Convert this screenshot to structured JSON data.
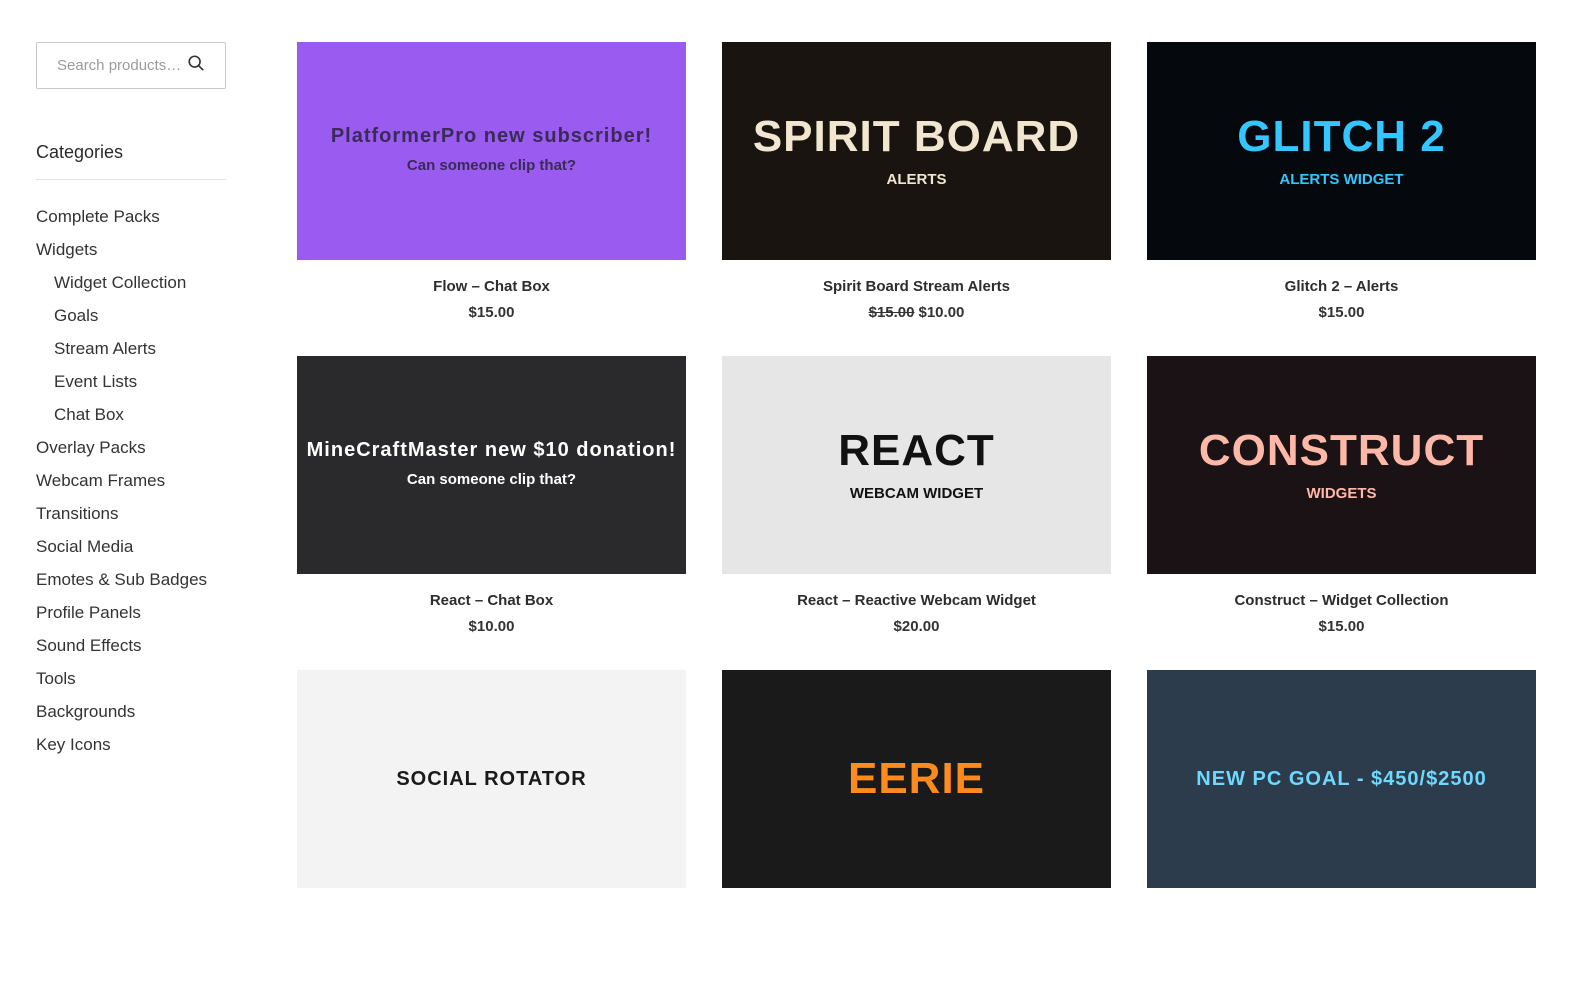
{
  "search": {
    "placeholder": "Search products…"
  },
  "sidebar": {
    "categories_title": "Categories",
    "items": [
      {
        "label": "Complete Packs",
        "sub": false
      },
      {
        "label": "Widgets",
        "sub": false
      },
      {
        "label": "Widget Collection",
        "sub": true
      },
      {
        "label": "Goals",
        "sub": true
      },
      {
        "label": "Stream Alerts",
        "sub": true
      },
      {
        "label": "Event Lists",
        "sub": true
      },
      {
        "label": "Chat Box",
        "sub": true
      },
      {
        "label": "Overlay Packs",
        "sub": false
      },
      {
        "label": "Webcam Frames",
        "sub": false
      },
      {
        "label": "Transitions",
        "sub": false
      },
      {
        "label": "Social Media",
        "sub": false
      },
      {
        "label": "Emotes & Sub Badges",
        "sub": false
      },
      {
        "label": "Profile Panels",
        "sub": false
      },
      {
        "label": "Sound Effects",
        "sub": false
      },
      {
        "label": "Tools",
        "sub": false
      },
      {
        "label": "Backgrounds",
        "sub": false
      },
      {
        "label": "Key Icons",
        "sub": false
      }
    ]
  },
  "products": [
    {
      "name": "Flow – Chat Box",
      "price": "$15.00",
      "old_price": "",
      "image_text": "PlatformerPro new subscriber!",
      "image_sub": "Can someone clip that?",
      "bg": "#9a5cf0",
      "fg": "#3a2a5a"
    },
    {
      "name": "Spirit Board Stream Alerts",
      "price": "$10.00",
      "old_price": "$15.00",
      "image_text": "SPIRIT BOARD",
      "image_sub": "ALERTS",
      "bg": "#1a1410",
      "fg": "#f1e6cf"
    },
    {
      "name": "Glitch 2 – Alerts",
      "price": "$15.00",
      "old_price": "",
      "image_text": "GLITCH 2",
      "image_sub": "ALERTS WIDGET",
      "bg": "#05080c",
      "fg": "#33c6ff"
    },
    {
      "name": "React – Chat Box",
      "price": "$10.00",
      "old_price": "",
      "image_text": "MineCraftMaster new $10 donation!",
      "image_sub": "Can someone clip that?",
      "bg": "#2a2a2c",
      "fg": "#ffffff"
    },
    {
      "name": "React – Reactive Webcam Widget",
      "price": "$20.00",
      "old_price": "",
      "image_text": "REACT",
      "image_sub": "WEBCAM WIDGET",
      "bg": "#e6e6e6",
      "fg": "#111111"
    },
    {
      "name": "Construct – Widget Collection",
      "price": "$15.00",
      "old_price": "",
      "image_text": "CONSTRUCT",
      "image_sub": "WIDGETS",
      "bg": "#1a1214",
      "fg": "#ffb8a8"
    },
    {
      "name": "",
      "price": "",
      "old_price": "",
      "image_text": "SOCIAL ROTATOR",
      "image_sub": "",
      "bg": "#f3f3f3",
      "fg": "#1a1a1a"
    },
    {
      "name": "",
      "price": "",
      "old_price": "",
      "image_text": "EERIE",
      "image_sub": "",
      "bg": "#1a1a1a",
      "fg": "#ff8a1e"
    },
    {
      "name": "",
      "price": "",
      "old_price": "",
      "image_text": "NEW PC GOAL - $450/$2500",
      "image_sub": "",
      "bg": "#2d3c4c",
      "fg": "#6fd8ff"
    }
  ]
}
